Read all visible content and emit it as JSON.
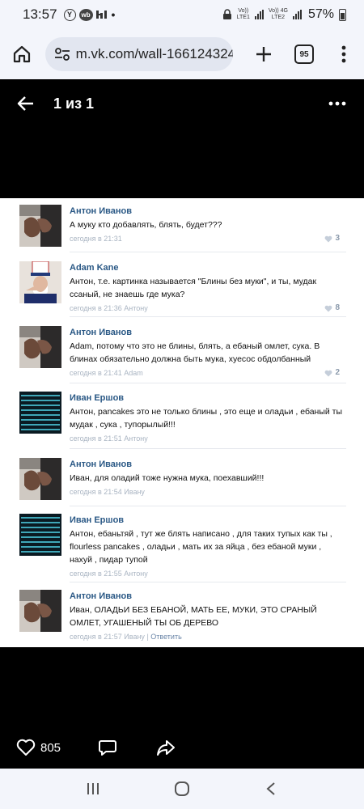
{
  "status": {
    "time": "13:57",
    "battery": "57%",
    "sim1_top": "Vo))",
    "sim1_bottom": "LTE1",
    "sim2_top": "Vo)) 4G",
    "sim2_bottom": "LTE2"
  },
  "browser": {
    "url": "m.vk.com/wall-166124324",
    "tab_count": "95"
  },
  "viewer": {
    "counter": "1 из 1"
  },
  "comments": [
    {
      "author": "Антон Иванов",
      "text": "А муку кто добавлять, блять, будет???",
      "meta": "сегодня в 21:31",
      "reply_to": "",
      "likes": "3",
      "avatar": "hands"
    },
    {
      "author": "Adam Kane",
      "text": "Антон, т.е. картинка называется \"Блины без муки\", и ты, мудак ссаный, не знаешь где мука?",
      "meta": "сегодня в 21:36 Антону",
      "reply_to": "",
      "likes": "8",
      "avatar": "uncle-sam"
    },
    {
      "author": "Антон Иванов",
      "text": "Adam, потому что это не блины, блять, а ебаный омлет, сука. В блинах обязательно должна быть мука, хуесос обдолбанный",
      "meta": "сегодня в 21:41 Adam",
      "reply_to": "",
      "likes": "2",
      "avatar": "hands"
    },
    {
      "author": "Иван Ершов",
      "text": "Антон, pancakes это не только блины , это еще и оладьи , ебаный ты мудак , сука , тупорылый!!!",
      "meta": "сегодня в 21:51 Антону",
      "reply_to": "",
      "likes": "",
      "avatar": "matrix"
    },
    {
      "author": "Антон Иванов",
      "text": "Иван, для оладий тоже нужна мука, поехавший!!!",
      "meta": "сегодня в 21:54 Ивану",
      "reply_to": "",
      "likes": "",
      "avatar": "hands"
    },
    {
      "author": "Иван Ершов",
      "text": "Антон, ебаньтяй , тут же блять написано , для таких тупых как ты , flourless pancakes , оладьи , мать их за яйца , без ебаной муки , нахуй , пидар тупой",
      "meta": "сегодня в 21:55 Антону",
      "reply_to": "",
      "likes": "",
      "avatar": "matrix"
    },
    {
      "author": "Антон Иванов",
      "text": "Иван, ОЛАДЬИ БЕЗ ЕБАНОЙ, МАТЬ ЕЕ, МУКИ, ЭТО СРАНЫЙ ОМЛЕТ, УГАШЕНЫЙ ТЫ ОБ ДЕРЕВО",
      "meta": "сегодня в 21:57 Ивану",
      "reply_to": "Ответить",
      "likes": "",
      "avatar": "hands"
    }
  ],
  "actions": {
    "likes": "805"
  },
  "colors": {
    "author": "#2a5885",
    "meta": "#a9b4c2",
    "background": "#000000",
    "bars": "#f3f5fb"
  }
}
